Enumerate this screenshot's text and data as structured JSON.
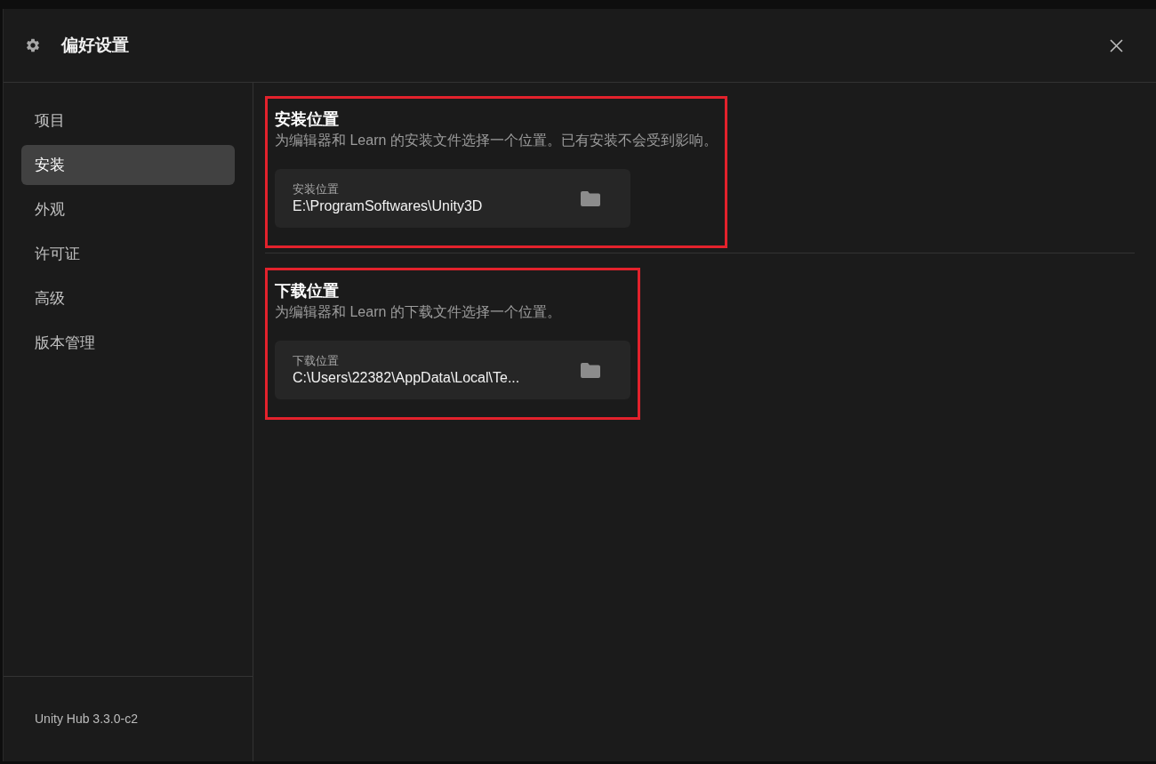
{
  "window": {
    "title": "偏好设置"
  },
  "sidebar": {
    "items": [
      {
        "label": "项目",
        "selected": false
      },
      {
        "label": "安装",
        "selected": true
      },
      {
        "label": "外观",
        "selected": false
      },
      {
        "label": "许可证",
        "selected": false
      },
      {
        "label": "高级",
        "selected": false
      },
      {
        "label": "版本管理",
        "selected": false
      }
    ],
    "version": "Unity Hub 3.3.0-c2"
  },
  "sections": [
    {
      "title": "安装位置",
      "description": "为编辑器和 Learn 的安装文件选择一个位置。已有安装不会受到影响。",
      "highlighted": true,
      "field": {
        "label": "安装位置",
        "value": "E:\\ProgramSoftwares\\Unity3D"
      }
    },
    {
      "title": "下载位置",
      "description": "为编辑器和 Learn 的下载文件选择一个位置。",
      "highlighted": true,
      "field": {
        "label": "下载位置",
        "value": "C:\\Users\\22382\\AppData\\Local\\Te..."
      }
    }
  ]
}
